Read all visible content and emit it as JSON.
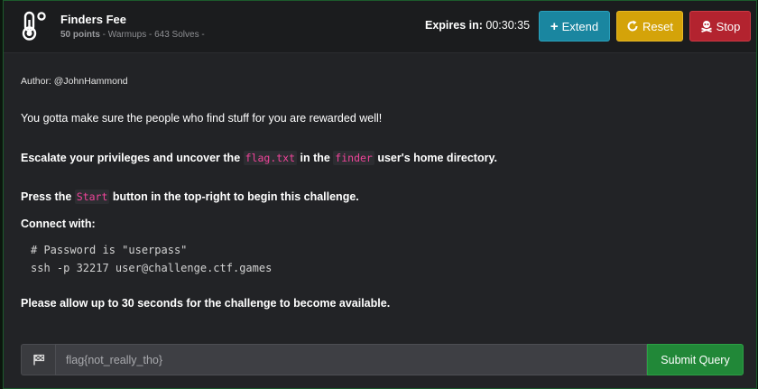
{
  "challenge": {
    "title": "Finders Fee",
    "points": "50 points",
    "meta_rest": " - Warmups - 643 Solves -",
    "expires_label": "Expires in:",
    "expires_value": " 00:30:35"
  },
  "buttons": {
    "extend": "Extend",
    "reset": "Reset",
    "stop": "Stop"
  },
  "description": {
    "author": "Author: @JohnHammond",
    "p1": "You gotta make sure the people who find stuff for you are rewarded well!",
    "p2_a": "Escalate your privileges and uncover the ",
    "p2_code1": "flag.txt",
    "p2_b": " in the ",
    "p2_code2": "finder",
    "p2_c": " user's home directory.",
    "p3_a": "Press the ",
    "p3_code": "Start",
    "p3_b": " button in the top-right to begin this challenge.",
    "p4": "Connect with:",
    "code_line1": "# Password is \"userpass\"",
    "code_line2": "ssh -p 32217 user@challenge.ctf.games",
    "p5": "Please allow up to 30 seconds for the challenge to become available."
  },
  "flag_form": {
    "value": "flag{not_really_tho}",
    "placeholder": "flag{not_really_tho}",
    "submit": "Submit Query"
  },
  "icons": {
    "header": "thermometer-icon",
    "extend": "plus-icon",
    "reset": "redo-icon",
    "stop": "skull-crossbones-icon",
    "flag": "flag-icon"
  },
  "colors": {
    "extend": "#1a86a0",
    "reset": "#d4a309",
    "stop": "#b3232f",
    "submit": "#218838",
    "code_highlight": "#f0449a",
    "border_accent": "#1c5a2c"
  }
}
